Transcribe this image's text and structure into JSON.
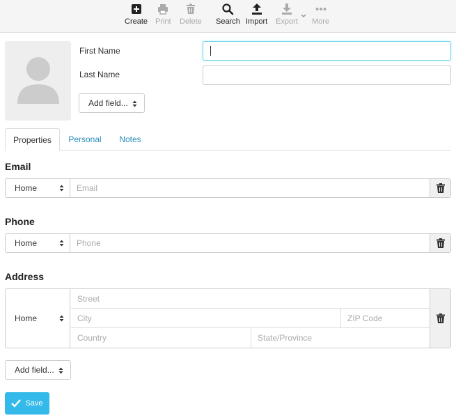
{
  "toolbar": {
    "create": "Create",
    "print": "Print",
    "delete": "Delete",
    "search": "Search",
    "import": "Import",
    "export": "Export",
    "more": "More"
  },
  "head": {
    "first_name_label": "First Name",
    "last_name_label": "Last Name",
    "first_name_value": "",
    "last_name_value": "",
    "add_field": "Add field..."
  },
  "tabs": [
    {
      "label": "Properties",
      "active": true
    },
    {
      "label": "Personal",
      "active": false
    },
    {
      "label": "Notes",
      "active": false
    }
  ],
  "email": {
    "title": "Email",
    "type": "Home",
    "placeholder": "Email"
  },
  "phone": {
    "title": "Phone",
    "type": "Home",
    "placeholder": "Phone"
  },
  "address": {
    "title": "Address",
    "type": "Home",
    "street": "Street",
    "city": "City",
    "zip": "ZIP Code",
    "country": "Country",
    "state": "State/Province"
  },
  "footer": {
    "add_field": "Add field...",
    "save": "Save"
  },
  "colors": {
    "accent": "#33b9ea",
    "link": "#2a8fbd",
    "focus_border": "#6fd3ea"
  }
}
